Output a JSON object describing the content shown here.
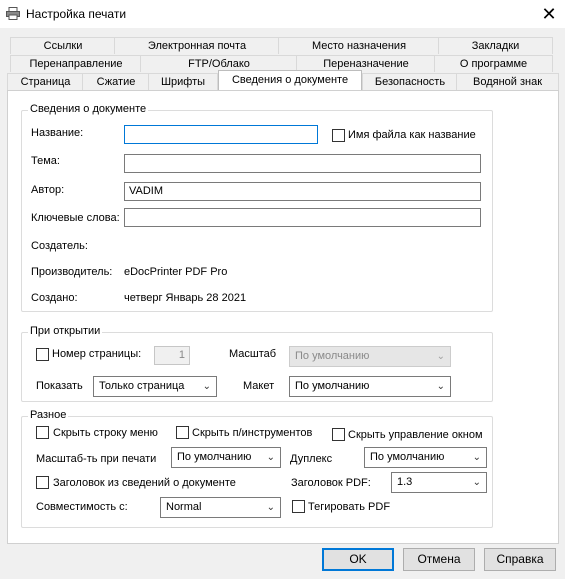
{
  "window": {
    "title": "Настройка печати",
    "close_glyph": "✕"
  },
  "tabs": {
    "row1": [
      "Ссылки",
      "Электронная почта",
      "Место назначения",
      "Закладки"
    ],
    "row2": [
      "Перенаправление",
      "FTP/Облако",
      "Переназначение",
      "О программе"
    ],
    "row3": [
      "Страница",
      "Сжатие",
      "Шрифты",
      "Сведения о документе",
      "Безопасность",
      "Водяной знак"
    ],
    "active": "Сведения о документе"
  },
  "doc_info": {
    "group_title": "Сведения о документе",
    "name_label": "Название:",
    "name_value": "",
    "filename_as_title_label": "Имя файла как название",
    "subject_label": "Тема:",
    "subject_value": "",
    "author_label": "Автор:",
    "author_value": "VADIM",
    "keywords_label": "Ключевые слова:",
    "keywords_value": "",
    "creator_label": "Создатель:",
    "producer_label": "Производитель:",
    "producer_value": "eDocPrinter PDF Pro",
    "created_label": "Создано:",
    "created_value": "четверг Январь 28 2021"
  },
  "on_open": {
    "group_title": "При открытии",
    "page_number_label": "Номер страницы:",
    "page_number_value": "1",
    "zoom_label": "Масштаб",
    "zoom_value": "По умолчанию",
    "show_label": "Показать",
    "show_value": "Только страница",
    "layout_label": "Макет",
    "layout_value": "По умолчанию"
  },
  "misc": {
    "group_title": "Разное",
    "hide_menubar_label": "Скрыть строку меню",
    "hide_toolbar_label": "Скрыть п/инструментов",
    "hide_window_ui_label": "Скрыть управление окном",
    "print_scaling_label": "Масштаб-ть при печати",
    "print_scaling_value": "По умолчанию",
    "duplex_label": "Дуплекс",
    "duplex_value": "По умолчанию",
    "title_from_docinfo_label": "Заголовок из сведений о документе",
    "pdf_header_label": "Заголовок PDF:",
    "pdf_header_value": "1.3",
    "compat_label": "Совместимость с:",
    "compat_value": "Normal",
    "tagged_pdf_label": "Тегировать PDF"
  },
  "buttons": {
    "ok": "OK",
    "cancel": "Отмена",
    "help": "Справка"
  },
  "icons": {
    "title": "printer-icon",
    "close": "close-icon",
    "dropdown": "chevron-down-icon"
  },
  "colors": {
    "focus_border": "#0078d7",
    "window_bg": "#f0f0f0",
    "panel_bg": "#ffffff"
  }
}
